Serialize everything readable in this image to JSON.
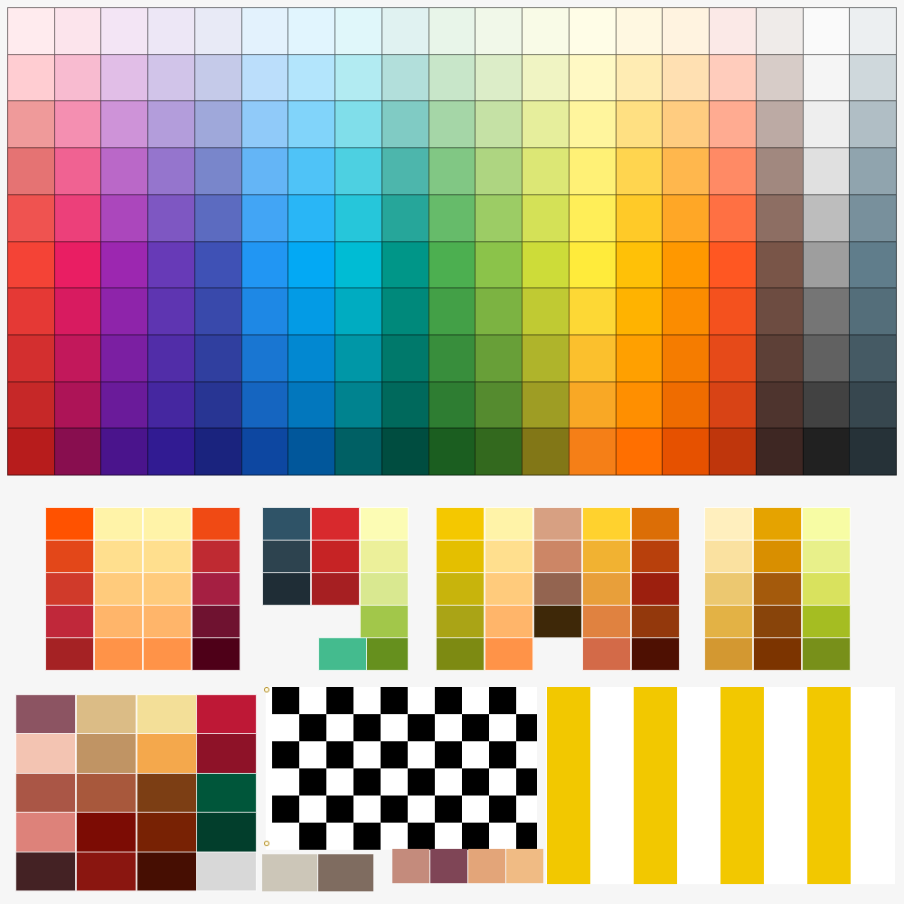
{
  "canvas": {
    "background": "#f6f6f6",
    "name": "color-palette-canvas"
  },
  "main_grid": {
    "columns": [
      [
        "#ffebee",
        "#ffcdd2",
        "#ef9a9a",
        "#e57373",
        "#ef5350",
        "#f44336",
        "#e53935",
        "#d32f2f",
        "#c62828",
        "#b71c1c"
      ],
      [
        "#fce4ec",
        "#f8bbd0",
        "#f48fb1",
        "#f06292",
        "#ec407a",
        "#e91e63",
        "#d81b60",
        "#c2185b",
        "#ad1457",
        "#880e4f"
      ],
      [
        "#f3e5f5",
        "#e1bee7",
        "#ce93d8",
        "#ba68c8",
        "#ab47bc",
        "#9c27b0",
        "#8e24aa",
        "#7b1fa2",
        "#6a1b9a",
        "#4a148c"
      ],
      [
        "#ede7f6",
        "#d1c4e9",
        "#b39ddb",
        "#9575cd",
        "#7e57c2",
        "#673ab7",
        "#5e35b1",
        "#512da8",
        "#4527a0",
        "#311b92"
      ],
      [
        "#e8eaf6",
        "#c5cae9",
        "#9fa8da",
        "#7986cb",
        "#5c6bc0",
        "#3f51b5",
        "#3949ab",
        "#303f9f",
        "#283593",
        "#1a237e"
      ],
      [
        "#e3f2fd",
        "#bbdefb",
        "#90caf9",
        "#64b5f6",
        "#42a5f5",
        "#2196f3",
        "#1e88e5",
        "#1976d2",
        "#1565c0",
        "#0d47a1"
      ],
      [
        "#e1f5fe",
        "#b3e5fc",
        "#81d4fa",
        "#4fc3f7",
        "#29b6f6",
        "#03a9f4",
        "#039be5",
        "#0288d1",
        "#0277bd",
        "#01579b"
      ],
      [
        "#e0f7fa",
        "#b2ebf2",
        "#80deea",
        "#4dd0e1",
        "#26c6da",
        "#00bcd4",
        "#00acc1",
        "#0097a7",
        "#00838f",
        "#006064"
      ],
      [
        "#e0f2f1",
        "#b2dfdb",
        "#80cbc4",
        "#4db6ac",
        "#26a69a",
        "#009688",
        "#00897b",
        "#00796b",
        "#00695c",
        "#004d40"
      ],
      [
        "#e8f5e9",
        "#c8e6c9",
        "#a5d6a7",
        "#81c784",
        "#66bb6a",
        "#4caf50",
        "#43a047",
        "#388e3c",
        "#2e7d32",
        "#1b5e20"
      ],
      [
        "#f1f8e9",
        "#dcedc8",
        "#c5e1a5",
        "#aed581",
        "#9ccc65",
        "#8bc34a",
        "#7cb342",
        "#689f38",
        "#558b2f",
        "#33691e"
      ],
      [
        "#f9fbe7",
        "#f0f4c3",
        "#e6ee9c",
        "#dce775",
        "#d4e157",
        "#cddc39",
        "#c0ca33",
        "#afb42b",
        "#9e9d24",
        "#827717"
      ],
      [
        "#fffde7",
        "#fff9c4",
        "#fff59d",
        "#fff176",
        "#ffee58",
        "#ffeb3b",
        "#fdd835",
        "#fbc02d",
        "#f9a825",
        "#f57f17"
      ],
      [
        "#fff8e1",
        "#ffecb3",
        "#ffe082",
        "#ffd54f",
        "#ffca28",
        "#ffc107",
        "#ffb300",
        "#ffa000",
        "#ff8f00",
        "#ff6f00"
      ],
      [
        "#fff3e0",
        "#ffe0b2",
        "#ffcc80",
        "#ffb74d",
        "#ffa726",
        "#ff9800",
        "#fb8c00",
        "#f57c00",
        "#ef6c00",
        "#e65100"
      ],
      [
        "#fbe9e7",
        "#ffccbc",
        "#ffab91",
        "#ff8a65",
        "#ff7043",
        "#ff5722",
        "#f4511e",
        "#e64a19",
        "#d84315",
        "#bf360c"
      ],
      [
        "#efebe9",
        "#d7ccc8",
        "#bcaaa4",
        "#a1887f",
        "#8d6e63",
        "#795548",
        "#6d4c41",
        "#5d4037",
        "#4e342e",
        "#3e2723"
      ],
      [
        "#fafafa",
        "#f5f5f5",
        "#eeeeee",
        "#e0e0e0",
        "#bdbdbd",
        "#9e9e9e",
        "#757575",
        "#616161",
        "#424242",
        "#212121"
      ],
      [
        "#eceff1",
        "#cfd8dc",
        "#b0bec5",
        "#90a4ae",
        "#78909c",
        "#607d8b",
        "#546e7a",
        "#455a64",
        "#37474f",
        "#263238"
      ]
    ]
  },
  "panels": {
    "panel_1": [
      [
        "#ff5200",
        "#e34719",
        "#d03a2a",
        "#c0283a",
        "#a52224"
      ],
      [
        "#fff3a8",
        "#ffdf8e",
        "#ffcb7c",
        "#ffb56a",
        "#ff9348"
      ],
      [
        "#fff3a8",
        "#ffdf8e",
        "#ffcb7c",
        "#ffb56a",
        "#ff9348"
      ],
      [
        "#f04a14",
        "#bf2a32",
        "#a51f42",
        "#6f1230",
        "#4e0018"
      ]
    ],
    "panel_2": [
      [
        "#2f5367",
        "#2d434f",
        "#1f2d36"
      ],
      [
        "#d8292d",
        "#c62325",
        "#a61f22"
      ],
      [
        "#fcfcb4",
        "#ecf09a",
        "#d9e890",
        "#a2c74a",
        "#66901e"
      ],
      [
        "#44bb8e"
      ]
    ],
    "panel_3": [
      [
        "#f4c800",
        "#e4bf00",
        "#c8b40c",
        "#aaa416",
        "#7d8a12"
      ],
      [
        "#fff3a8",
        "#ffdf8e",
        "#ffcb7c",
        "#ffb56a",
        "#ff9348"
      ],
      [
        "#d7a082",
        "#cc8666",
        "#936450",
        "#3e2808"
      ],
      [
        "#ffd22e",
        "#f1b232",
        "#e89f3a",
        "#e08240",
        "#d36a48"
      ],
      [
        "#dc6e06",
        "#b8400c",
        "#9c1f0e",
        "#93380c",
        "#4e1002"
      ]
    ],
    "panel_4": [
      [
        "#ffefbe",
        "#fae1a0",
        "#ecc870",
        "#e3b245",
        "#d39831"
      ],
      [
        "#e5a300",
        "#d98f00",
        "#a45a0c",
        "#88440a",
        "#7c3400"
      ],
      [
        "#f7fca4",
        "#e8f08a",
        "#d9e25e",
        "#a5bd22",
        "#78901a"
      ]
    ],
    "panel_5": [
      [
        "#8c5462",
        "#f3c4b2",
        "#aa5646",
        "#dd827a",
        "#442224"
      ],
      [
        "#dbbc86",
        "#c09464",
        "#a8583c",
        "#7c0c04",
        "#8a1610"
      ],
      [
        "#f3df98",
        "#f4a84c",
        "#7c3e14",
        "#782204",
        "#460e02"
      ],
      [
        "#be1836",
        "#8e1228",
        "#00563a",
        "#023e2c",
        "#d8d8d8"
      ]
    ],
    "bottom_swatches": [
      "#ccc6b8",
      "#7f6c60"
    ],
    "bottom_strip": [
      "#c48b7c",
      "#7f4556",
      "#e3a579",
      "#f0bb84"
    ],
    "stripes": {
      "color": "#f2c800",
      "background": "#ffffff"
    },
    "checkerboard": {
      "dark": "#000000",
      "light": "#ffffff"
    }
  }
}
